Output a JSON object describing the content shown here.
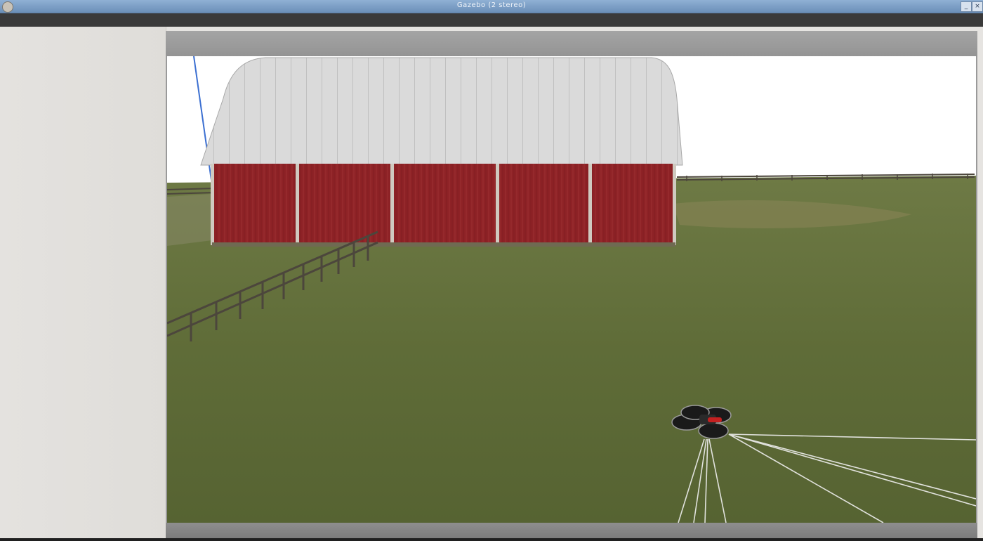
{
  "window": {
    "title": "Gazebo (2 stereo)",
    "min_glyph": "_",
    "close_glyph": "×"
  },
  "colors": {
    "sky": "#ffffff",
    "grass": "#5e6d36",
    "barn_wall": "#8b1f22",
    "barn_roof": "#d9d9d9",
    "fence": "#4c463c",
    "drone_body": "#1a1a1a",
    "drone_accent": "#c42020",
    "sensor_rays": "#f2f2f2"
  },
  "scene": {
    "objects": [
      "barn",
      "fence",
      "quadrotor-drone",
      "laser-rays"
    ]
  }
}
